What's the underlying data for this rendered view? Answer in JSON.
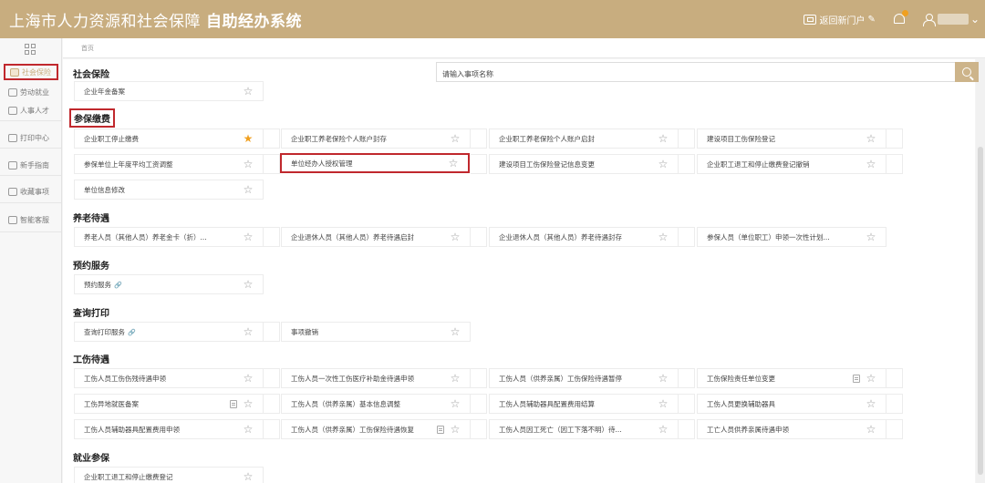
{
  "header": {
    "title_light": "上海市人力资源和社会保障",
    "title_bold": "自助经办系统",
    "portal_label": "返回新门户",
    "accent": "#c8ad7f"
  },
  "sidebar": {
    "grid_icon": "grid-icon",
    "items": [
      {
        "label": "社会保险",
        "icon": "folder-icon",
        "active": true
      },
      {
        "label": "劳动就业",
        "icon": "user-icon"
      },
      {
        "label": "人事人才",
        "icon": "people-icon"
      },
      {
        "label": "打印中心",
        "icon": "printer-icon"
      },
      {
        "label": "新手指南",
        "icon": "guide-icon"
      },
      {
        "label": "收藏事项",
        "icon": "star-icon"
      },
      {
        "label": "智能客服",
        "icon": "service-icon"
      }
    ]
  },
  "breadcrumb": "首页",
  "search": {
    "placeholder": "请输入事项名称",
    "button_icon": "search-icon"
  },
  "sections": {
    "shebao": "社会保险",
    "cbjf": "参保缴费",
    "yldy": "养老待遇",
    "yyfw": "预约服务",
    "cxdy": "查询打印",
    "gsdy": "工伤待遇",
    "jycb": "就业参保"
  },
  "tiles": {
    "t0": "企业年金备案",
    "cb1": "企业职工停止缴费",
    "cb2": "企业职工养老保险个人账户封存",
    "cb3": "企业职工养老保险个人账户启封",
    "cb4": "建设项目工伤保险登记",
    "cb5": "参保单位上年度平均工资调整",
    "cb6": "单位经办人授权管理",
    "cb7": "建设项目工伤保险登记信息变更",
    "cb8": "企业职工退工和停止缴费登记撤销",
    "cb9": "单位信息修改",
    "yl1": "养老人员（其他人员）养老金卡（折）...",
    "yl2": "企业退休人员（其他人员）养老待遇启封",
    "yl3": "企业退休人员（其他人员）养老待遇封存",
    "yl4": "参保人员（单位职工）申领一次性计划...",
    "yy1": "预约服务",
    "cx1": "查询打印服务",
    "cx2": "事项撤销",
    "gs1": "工伤人员工伤伤残待遇申领",
    "gs2": "工伤人员一次性工伤医疗补助金待遇申领",
    "gs3": "工伤人员（供养亲属）工伤保险待遇暂停",
    "gs4": "工伤保险责任单位变更",
    "gs5": "工伤异地就医备案",
    "gs6": "工伤人员（供养亲属）基本信息调整",
    "gs7": "工伤人员辅助器具配置费用结算",
    "gs8": "工伤人员更换辅助器具",
    "gs9": "工伤人员辅助器具配置费用申领",
    "gs10": "工伤人员（供养亲属）工伤保险待遇恢复",
    "gs11": "工伤人员因工死亡（因工下落不明）待...",
    "gs12": "工亡人员供养亲属待遇申领",
    "jy1": "企业职工退工和停止缴费登记"
  },
  "icons": {
    "star": "star-outline-icon",
    "star_fav": "star-filled-icon",
    "doc": "document-icon",
    "link": "link-icon"
  }
}
